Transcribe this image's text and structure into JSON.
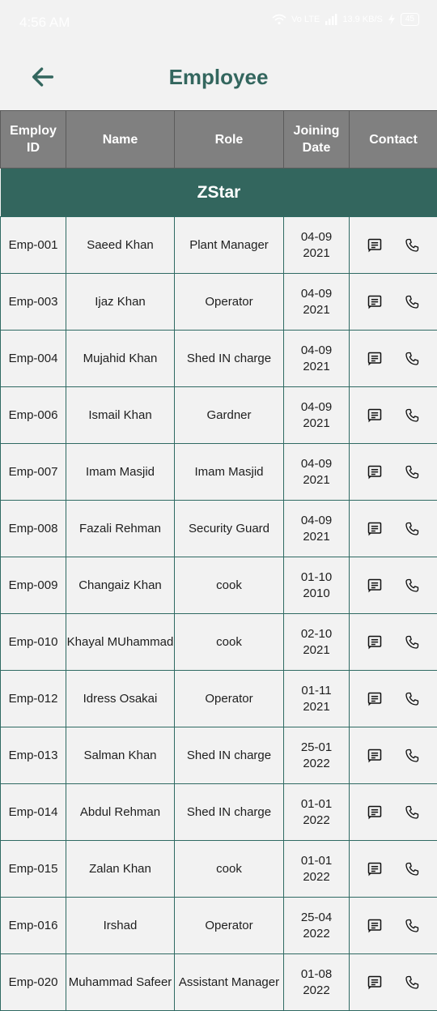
{
  "status_bar": {
    "time": "4:56 AM",
    "network_type": "Vo LTE",
    "data_speed": "13.9 KB/S",
    "battery": "45"
  },
  "header": {
    "title": "Employee"
  },
  "table": {
    "columns": [
      "Employ ID",
      "Name",
      "Role",
      "Joining Date",
      "Contact"
    ],
    "group_label": "ZStar",
    "rows": [
      {
        "id": "Emp-001",
        "name": "Saeed Khan",
        "role": "Plant Manager",
        "date_day": "04-09",
        "date_year": "2021"
      },
      {
        "id": "Emp-003",
        "name": "Ijaz Khan",
        "role": "Operator",
        "date_day": "04-09",
        "date_year": "2021"
      },
      {
        "id": "Emp-004",
        "name": "Mujahid Khan",
        "role": "Shed IN charge",
        "date_day": "04-09",
        "date_year": "2021"
      },
      {
        "id": "Emp-006",
        "name": "Ismail Khan",
        "role": "Gardner",
        "date_day": "04-09",
        "date_year": "2021"
      },
      {
        "id": "Emp-007",
        "name": "Imam Masjid",
        "role": "Imam Masjid",
        "date_day": "04-09",
        "date_year": "2021"
      },
      {
        "id": "Emp-008",
        "name": "Fazali Rehman",
        "role": "Security Guard",
        "date_day": "04-09",
        "date_year": "2021"
      },
      {
        "id": "Emp-009",
        "name": "Changaiz Khan",
        "role": "cook",
        "date_day": "01-10",
        "date_year": "2010"
      },
      {
        "id": "Emp-010",
        "name": "Khayal MUhammad",
        "role": "cook",
        "date_day": "02-10",
        "date_year": "2021"
      },
      {
        "id": "Emp-012",
        "name": "Idress Osakai",
        "role": "Operator",
        "date_day": "01-11",
        "date_year": "2021"
      },
      {
        "id": "Emp-013",
        "name": "Salman Khan",
        "role": "Shed IN charge",
        "date_day": "25-01",
        "date_year": "2022"
      },
      {
        "id": "Emp-014",
        "name": "Abdul Rehman",
        "role": "Shed IN charge",
        "date_day": "01-01",
        "date_year": "2022"
      },
      {
        "id": "Emp-015",
        "name": "Zalan Khan",
        "role": "cook",
        "date_day": "01-01",
        "date_year": "2022"
      },
      {
        "id": "Emp-016",
        "name": "Irshad",
        "role": "Operator",
        "date_day": "25-04",
        "date_year": "2022"
      },
      {
        "id": "Emp-020",
        "name": "Muhammad Safeer",
        "role": "Assistant Manager",
        "date_day": "01-08",
        "date_year": "2022"
      }
    ]
  },
  "icons": {
    "back": "arrow-left-icon",
    "message": "message-icon",
    "phone": "phone-icon"
  },
  "colors": {
    "accent": "#33665e",
    "header_bg": "#808080",
    "page_bg": "#f2f2f2"
  }
}
